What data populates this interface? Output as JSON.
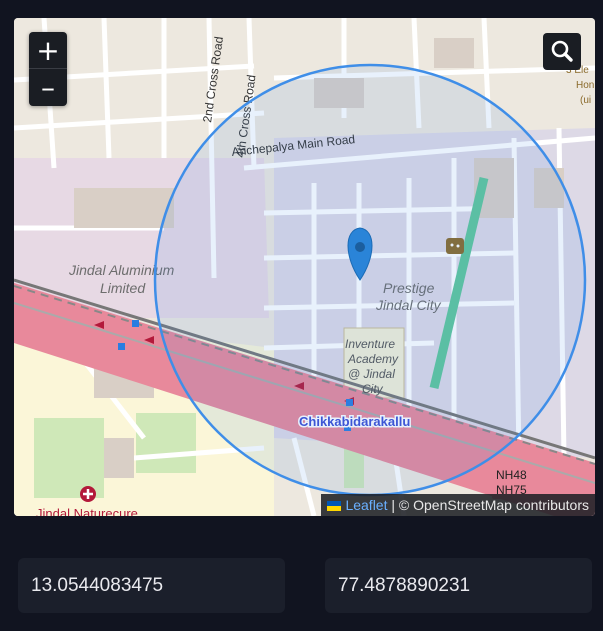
{
  "map": {
    "zoom_in_label": "+",
    "zoom_out_label": "–",
    "search_icon": "search-icon",
    "labels": {
      "road_2nd_cross": "2nd Cross Road",
      "road_4th_cross": "4th Cross Road",
      "road_anchepalya": "Anchepalya Main Road",
      "place_jindal_aluminium_1": "Jindal Aluminium",
      "place_jindal_aluminium_2": "Limited",
      "place_prestige_1": "Prestige",
      "place_prestige_2": "Jindal City",
      "place_inventure_1": "Inventure",
      "place_inventure_2": "Academy",
      "place_inventure_3": "@ Jindal",
      "place_inventure_4": "City",
      "station": "Chikkabidarakallu",
      "hospital": "Jindal Naturecure",
      "hwy_1": "NH48",
      "hwy_2": "NH75",
      "edge_1": "3 Ele",
      "edge_2": "Hon",
      "edge_3": "(ui"
    },
    "colors": {
      "circle": "#3f8ee8",
      "marker": "#2a84d8",
      "highway": "#e8899b",
      "station_text": "#3d4fd3"
    },
    "attribution": {
      "leaflet": "Leaflet",
      "separator": " | © ",
      "osm": "OpenStreetMap contributors"
    }
  },
  "coordinates": {
    "latitude": "13.0544083475",
    "longitude": "77.4878890231"
  }
}
